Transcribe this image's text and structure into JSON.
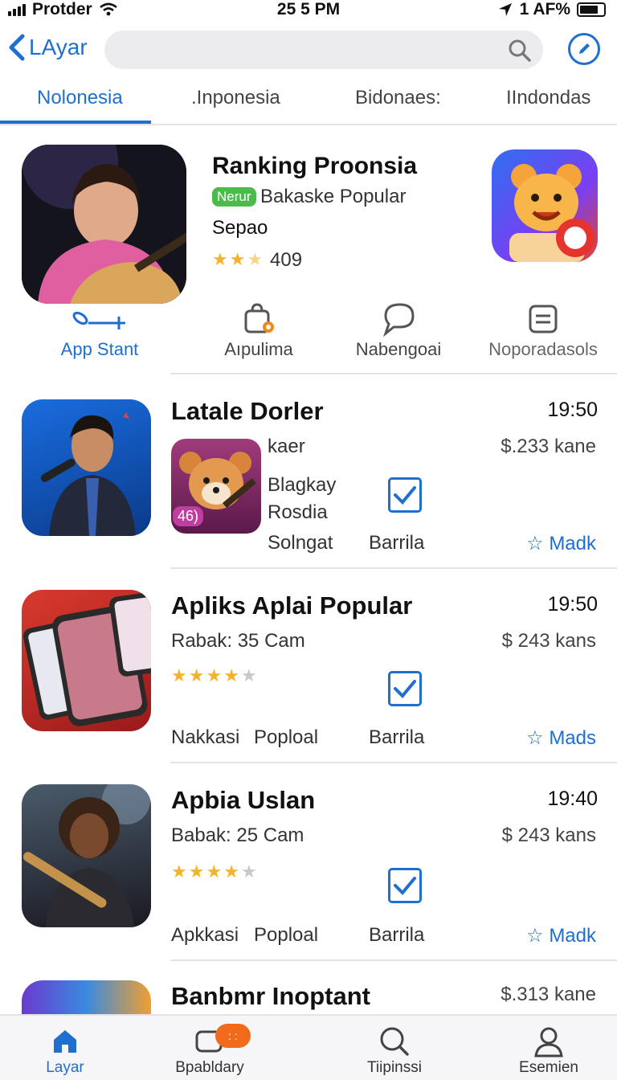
{
  "status_bar": {
    "carrier": "Protder",
    "time": "25 5 PM",
    "battery_text": "1 AF%"
  },
  "topbar": {
    "back_label": "LAyar",
    "search_placeholder": "",
    "icons": [
      "chevron-left-icon",
      "search-icon",
      "edit-icon"
    ]
  },
  "tabs": [
    {
      "label": "Nolonesia",
      "active": true
    },
    {
      "label": ".Inponesia",
      "active": false
    },
    {
      "label": "Bidonaes:",
      "active": false
    },
    {
      "label": "IIndondas",
      "active": false
    }
  ],
  "featured": {
    "title": "Ranking Proonsia",
    "badge": "Nerur",
    "subtitle": "Bakaske Popular",
    "subtitle2": "Sepao",
    "rating": 2.5,
    "rating_count": "409"
  },
  "actions": [
    {
      "label": "App Stant",
      "icon": "share-link-icon"
    },
    {
      "label": "Aıpulima",
      "icon": "bag-icon"
    },
    {
      "label": "Nabengoai",
      "icon": "chat-bubble-icon"
    },
    {
      "label": "Noporadasols",
      "icon": "list-icon"
    }
  ],
  "items": [
    {
      "title": "Latale Dorler",
      "time": "19:50",
      "col1": [
        "kaer",
        "Blagkay",
        "Rosdia",
        "Solngat"
      ],
      "inner_badge": "46)",
      "price": "$.233 kane",
      "checkbox_label": "Barrila",
      "mark": "Madk"
    },
    {
      "title": "Apliks Aplai Popular",
      "time": "19:50",
      "meta": "Rabak: 35 Cam",
      "rating": 4,
      "price": "$ 243 kans",
      "tags": [
        "Nakkasi",
        "Poploal"
      ],
      "checkbox_label": "Barrila",
      "mark": "Mads"
    },
    {
      "title": "Apbia Uslan",
      "time": "19:40",
      "meta": "Babak: 25 Cam",
      "rating": 4,
      "price": "$ 243 kans",
      "tags": [
        "Apkkasi",
        "Poploal"
      ],
      "checkbox_label": "Barrila",
      "mark": "Madk"
    },
    {
      "title": "Banbmr Inoptant",
      "price": "$.313 kane"
    }
  ],
  "bottom_nav": [
    {
      "label": "Layar",
      "icon": "home-icon",
      "active": true
    },
    {
      "label": "Bpabldary",
      "icon": "chat-icon",
      "badge": ": :"
    },
    {
      "label": "Tiipinssi",
      "icon": "search-icon"
    },
    {
      "label": "Esemien",
      "icon": "profile-icon"
    }
  ],
  "colors": {
    "accent": "#1f6fd1",
    "star": "#f4b32a",
    "badge_green": "#4cbb4c",
    "nav_badge": "#f26b1d"
  }
}
